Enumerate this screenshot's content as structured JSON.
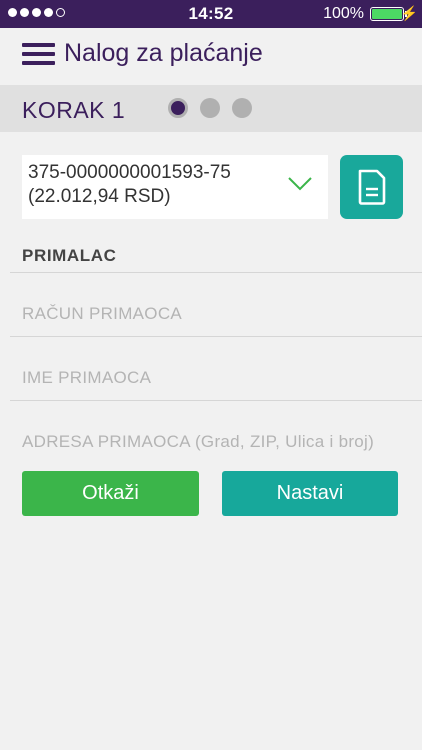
{
  "status_bar": {
    "time": "14:52",
    "battery_percent": "100%",
    "signal_bars_filled": 4,
    "signal_bars_total": 5,
    "battery_level": 1.0,
    "charging": true
  },
  "header": {
    "menu_icon": "hamburger-icon",
    "title": "Nalog za plaćanje"
  },
  "step_bar": {
    "label": "KORAK 1",
    "current_step": 1,
    "total_steps": 3
  },
  "account": {
    "number": "375-0000000001593-75",
    "balance": "(22.012,94 RSD)",
    "dropdown_icon": "chevron-down-icon",
    "document_icon": "document-icon"
  },
  "form": {
    "section_label": "PRIMALAC",
    "account_placeholder": "RAČUN PRIMAOCA",
    "name_placeholder": "IME PRIMAOCA",
    "address_placeholder": "ADRESA PRIMAOCA (Grad, ZIP, Ulica i broj)"
  },
  "buttons": {
    "cancel": "Otkaži",
    "next": "Nastavi"
  },
  "colors": {
    "primary": "#3b1f5c",
    "teal": "#19a89b",
    "green": "#3bb54a",
    "background": "#f1f1f1"
  }
}
